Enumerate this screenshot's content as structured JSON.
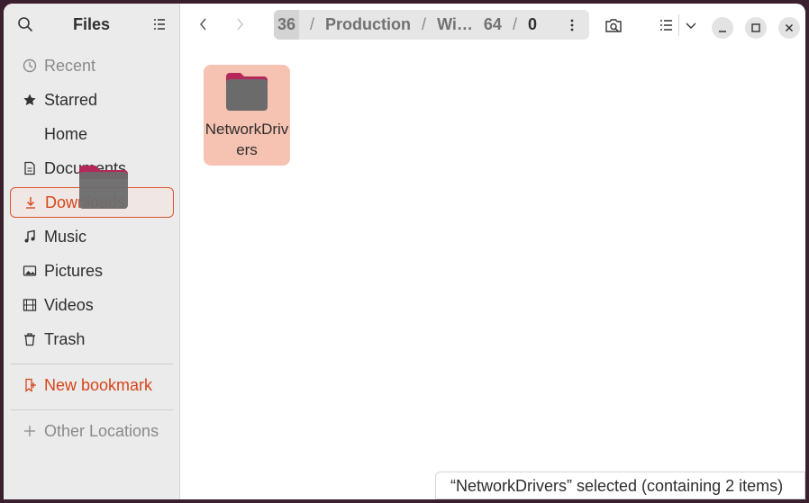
{
  "sidebar": {
    "title": "Files",
    "items": [
      {
        "label": "Recent",
        "icon": "clock-icon"
      },
      {
        "label": "Starred",
        "icon": "star-icon"
      },
      {
        "label": "Home",
        "icon": "home-icon"
      },
      {
        "label": "Documents",
        "icon": "document-icon"
      },
      {
        "label": "Downloads",
        "icon": "download-icon"
      },
      {
        "label": "Music",
        "icon": "music-icon"
      },
      {
        "label": "Pictures",
        "icon": "picture-icon"
      },
      {
        "label": "Videos",
        "icon": "film-icon"
      },
      {
        "label": "Trash",
        "icon": "trash-icon"
      }
    ],
    "new_bookmark": "New bookmark",
    "other_locations": "Other Locations"
  },
  "pathbar": {
    "segments": [
      "36",
      "Production",
      "Wi…",
      "64",
      "0"
    ]
  },
  "files": [
    {
      "name": "NetworkDrivers",
      "icon": "folder-icon"
    }
  ],
  "status": "“NetworkDrivers” selected  (containing 2 items)",
  "colors": {
    "accent": "#e0552b",
    "selection": "#f6c2b1",
    "folder_tab": "#b5285a",
    "folder_body": "#6b6b6b"
  }
}
